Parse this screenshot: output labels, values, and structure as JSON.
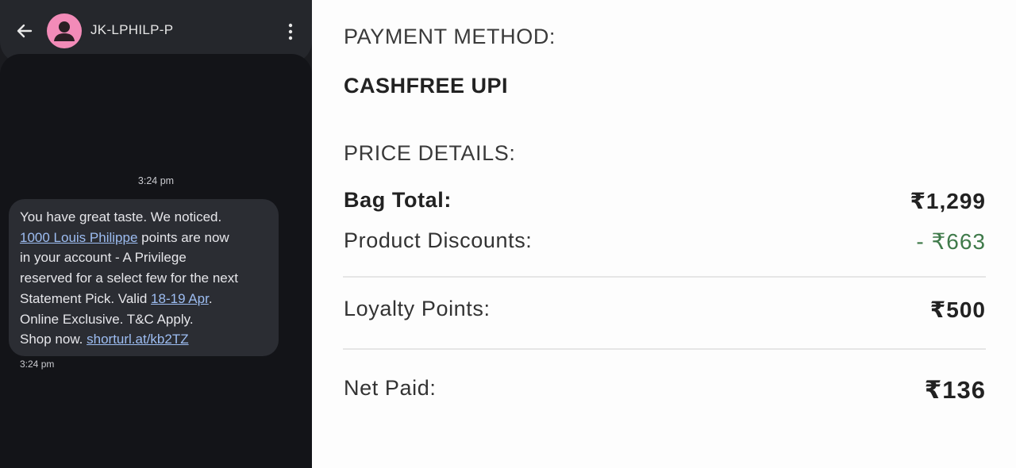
{
  "sms": {
    "contact_name": "JK-LPHILP-P",
    "timestamp_top": "3:24 pm",
    "message_lines": {
      "l1": "You have great taste. We noticed.",
      "l2_link": "1000 Louis Philippe",
      "l2_rest": " points are now",
      "l3": "in your account - A Privilege",
      "l4": "reserved for a select few for the next",
      "l5_pre": "Statement Pick. Valid ",
      "l5_link": "18-19 Apr",
      "l5_post": ".",
      "l6": "Online Exclusive. T&C Apply.",
      "l7_pre": "Shop now. ",
      "l7_link": "shorturl.at/kb2TZ"
    },
    "timestamp_bottom": "3:24 pm",
    "icons": [
      "back-arrow-icon",
      "person-icon",
      "more-vert-icon"
    ],
    "avatar_color": "#f28bb8",
    "link_color": "#9dbdf2"
  },
  "summary": {
    "payment_method_title": "PAYMENT METHOD:",
    "payment_method_value": "CASHFREE UPI",
    "price_details_title": "PRICE DETAILS:",
    "bag_total_label": "Bag Total:",
    "bag_total_value": "₹1,299",
    "product_discounts_label": "Product Discounts:",
    "product_discounts_value": "- ₹663",
    "loyalty_points_label": "Loyalty Points:",
    "loyalty_points_value": "₹500",
    "net_paid_label": "Net Paid:",
    "net_paid_value": "₹136",
    "discount_color": "#3f7a4a"
  }
}
